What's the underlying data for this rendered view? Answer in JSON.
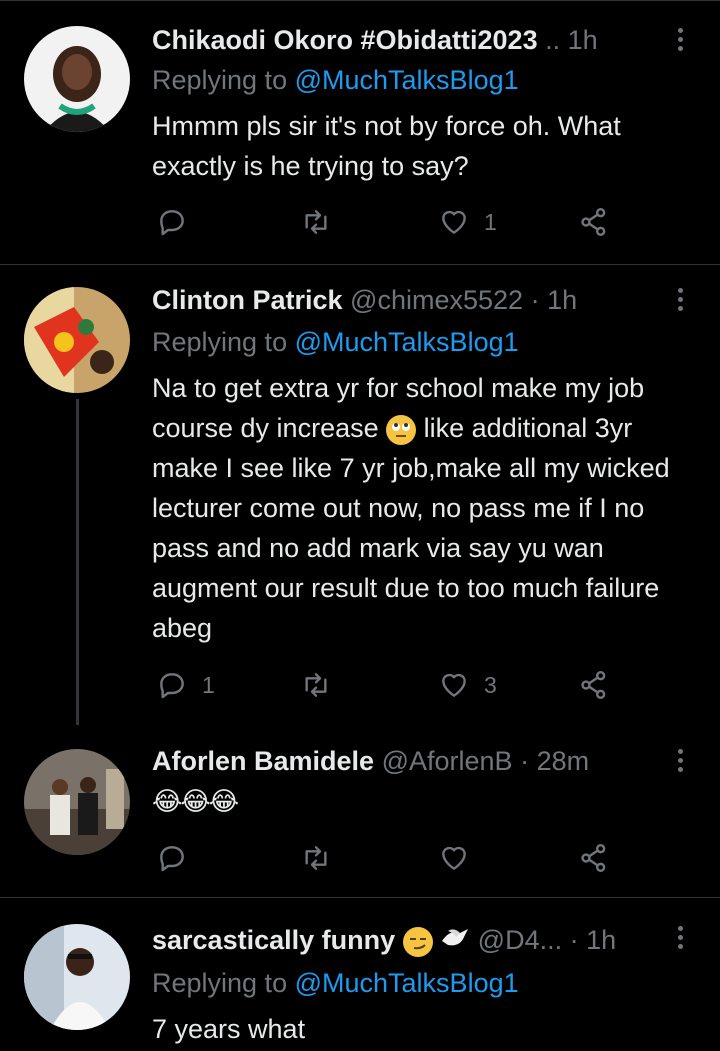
{
  "tweets": [
    {
      "name": "Chikaodi Okoro #Obidatti2023",
      "handle": "",
      "dot": "..",
      "time": "1h",
      "replying_prefix": "Replying to",
      "mention": "@MuchTalksBlog1",
      "text": "Hmmm pls sir it's not by force oh. What exactly is he trying to say?",
      "reply_count": "",
      "retweet_count": "",
      "like_count": "1"
    },
    {
      "name": "Clinton Patrick",
      "handle": "@chimex5522",
      "dot": "·",
      "time": "1h",
      "replying_prefix": "Replying to",
      "mention": "@MuchTalksBlog1",
      "text_part1": "Na to get extra yr for school make my job course dy increase",
      "text_part2": " like additional 3yr make I see like 7 yr job,make all my wicked lecturer come out now, no pass me if I no pass and no add mark via say yu wan augment our result due to too much failure abeg",
      "reply_count": "1",
      "retweet_count": "",
      "like_count": "3"
    },
    {
      "name": "Aforlen Bamidele",
      "handle": "@AforlenB",
      "dot": "·",
      "time": "28m",
      "text": "😂😂😂",
      "reply_count": "",
      "retweet_count": "",
      "like_count": ""
    },
    {
      "name": "sarcastically funny",
      "handle": "@D4...",
      "dot": "·",
      "time": "1h",
      "replying_prefix": "Replying to",
      "mention": "@MuchTalksBlog1",
      "text": "7 years what"
    }
  ],
  "icons": [
    "reply-icon",
    "retweet-icon",
    "like-icon",
    "share-icon",
    "more-icon"
  ],
  "colors": {
    "background": "#000000",
    "text": "#e7e9ea",
    "muted": "#71767b",
    "link": "#1d9bf0",
    "divider": "#2f3336"
  }
}
